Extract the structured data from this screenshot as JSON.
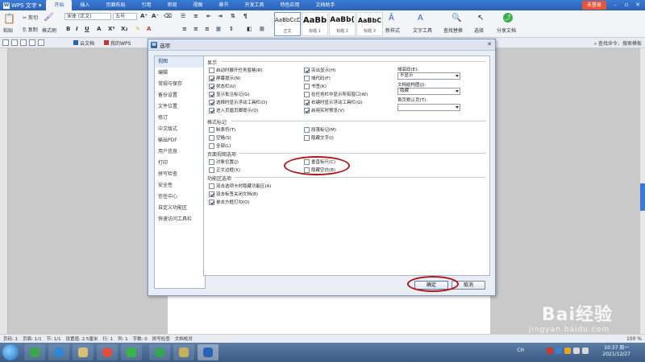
{
  "app": {
    "name": "WPS 文字",
    "menu_tabs": [
      "开始",
      "插入",
      "页面布局",
      "引用",
      "审阅",
      "视图",
      "章节",
      "开发工具",
      "特色应用",
      "文档助手"
    ],
    "active_tab": "开始",
    "login_label": "未登录"
  },
  "ribbon": {
    "paste": "粘贴",
    "cut": "剪切",
    "copy": "复制",
    "format_painter": "格式刷",
    "font_name": "宋体 (正文)",
    "font_size": "五号",
    "styles": [
      {
        "preview": "AaBbCcDd",
        "caption": "正文"
      },
      {
        "preview": "AaBb",
        "caption": "标题 1"
      },
      {
        "preview": "AaBb(",
        "caption": "标题 2"
      },
      {
        "preview": "AaBbC",
        "caption": "标题 3"
      }
    ],
    "new_style": "新样式",
    "text_tools": "文字工具",
    "find_replace": "查找替换",
    "select": "选择",
    "share": "分享文档"
  },
  "tabstrip": {
    "cloud_doc": "云文档",
    "my_wps": "我的WPS",
    "search_cmd": "查找命令、搜索模板"
  },
  "dialog": {
    "title": "选项",
    "nav": [
      "视图",
      "编辑",
      "常规与保存",
      "备份设置",
      "文件位置",
      "修订",
      "中文版式",
      "输出PDF",
      "用户信息",
      "打印",
      "拼写检查",
      "安全性",
      "信任中心",
      "自定义功能区",
      "快速访问工具栏"
    ],
    "active_nav": "视图",
    "section_show": "显示",
    "show_left": [
      {
        "label": "启动时展开任务窗格(R)",
        "checked": false
      },
      {
        "label": "屏幕提示(N)",
        "checked": true
      },
      {
        "label": "状态栏(U)",
        "checked": true
      },
      {
        "label": "显示批注标记(G)",
        "checked": true
      },
      {
        "label": "选择时显示浮动工具栏(D)",
        "checked": true
      },
      {
        "label": "进入页眉页脚提示(Q)",
        "checked": true
      }
    ],
    "show_mid": [
      {
        "label": "突出显示(H)",
        "checked": true
      },
      {
        "label": "域代码(F)",
        "checked": false
      },
      {
        "label": "书签(K)",
        "checked": false
      },
      {
        "label": "在任务栏中显示所有窗口(W)",
        "checked": false
      },
      {
        "label": "右键时显示浮动工具栏(G)",
        "checked": true
      },
      {
        "label": "启用实时预览(V)",
        "checked": true
      }
    ],
    "field_shading_label": "域底纹(E):",
    "field_shading_value": "不显示",
    "doc_structure_label": "文档结构图(J):",
    "doc_structure_value": "隐藏",
    "first_page_label": "首页默认页(T):",
    "first_page_value": "",
    "section_format": "格式标记",
    "format_left": [
      {
        "label": "制表符(T)",
        "checked": false
      },
      {
        "label": "空格(S)",
        "checked": false
      },
      {
        "label": "全部(L)",
        "checked": false
      }
    ],
    "format_mid": [
      {
        "label": "段落标记(M)",
        "checked": false
      },
      {
        "label": "隐藏文字(I)",
        "checked": false
      }
    ],
    "section_page": "页面视图选项",
    "page_left": [
      {
        "label": "对象位置(J)",
        "checked": false
      },
      {
        "label": "正文边框(X)",
        "checked": false
      }
    ],
    "page_mid": [
      {
        "label": "垂直标尺(C)",
        "checked": false
      },
      {
        "label": "隐藏空白(B)",
        "checked": false
      }
    ],
    "section_ribbon": "功能区选项",
    "ribbon_opts": [
      {
        "label": "双击选项卡时隐藏功能区(A)",
        "checked": false
      },
      {
        "label": "双击标签关闭文档(B)",
        "checked": true
      },
      {
        "label": "单击方框打勾(O)",
        "checked": true
      }
    ],
    "ok_label": "确定",
    "cancel_label": "取消"
  },
  "status_bar": {
    "items": [
      "页码: 1",
      "页面: 1/1",
      "节: 1/1",
      "设置值: 2.5厘米",
      "行: 1",
      "列: 1",
      "字数: 0",
      "拼写检查",
      "文档校对"
    ],
    "zoom": "100 %"
  },
  "taskbar": {
    "ime": "CH",
    "time": "10:37 周一",
    "date": "2021/12/27"
  },
  "watermark": {
    "brand": "Bai经验",
    "sub": "jingyan.baidu.com"
  },
  "colors": {
    "title_blue": "#2c62b5",
    "highlight_red": "#b2161c",
    "scroll_accent": "#3a7bd5"
  }
}
